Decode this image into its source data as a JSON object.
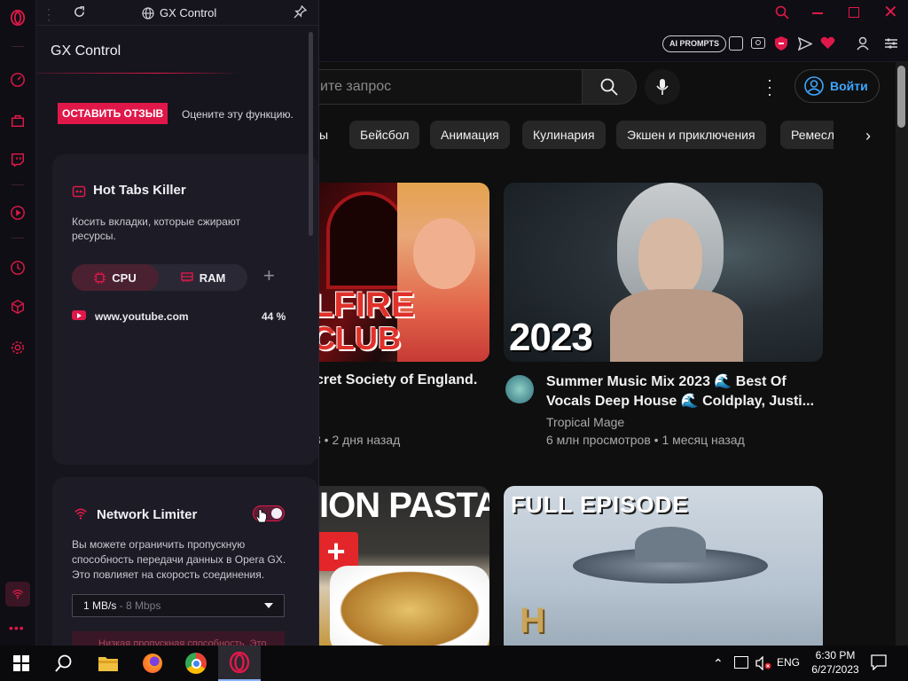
{
  "panel": {
    "header_title": "GX Control",
    "title": "GX Control",
    "feedback_button": "ОСТАВИТЬ ОТЗЫВ",
    "feedback_text": "Оцените эту функцию.",
    "tabs_killer": {
      "title": "Hot Tabs Killer",
      "description": "Косить вкладки, которые сжирают ресурсы.",
      "cpu_label": "CPU",
      "ram_label": "RAM",
      "active_tab": "CPU",
      "site": "www.youtube.com",
      "usage": "44 %"
    },
    "network_limiter": {
      "title": "Network Limiter",
      "enabled": true,
      "description": "Вы можете ограничить пропускную способность передачи данных в Opera GX. Это повлияет на скорость соединения.",
      "limit_value": "1 MB/s",
      "limit_sub": " - 8 Mbps",
      "cut_text": "Низкая пропускная способность. Это"
    }
  },
  "browser": {
    "ai_prompts": "AI PROMPTS"
  },
  "youtube": {
    "search_placeholder": "ите запрос",
    "signin": "Войти",
    "chips": [
      "ы",
      "Бейсбол",
      "Анимация",
      "Кулинария",
      "Экшен и приключения",
      "Ремесл"
    ],
    "videos": [
      {
        "title": "cret Society of England.",
        "channel": "",
        "meta": "3 • 2 дня назад",
        "thumb_text_1": "LFIRE",
        "thumb_text_2": "CLUB"
      },
      {
        "title_1": "Summer Music Mix 2023 🌊 Best Of",
        "title_2": "Vocals Deep House 🌊 Coldplay, Justi...",
        "channel": "Tropical Mage",
        "meta": "6 млн просмотров • 1 месяц назад",
        "thumb_text": "2023"
      },
      {
        "thumb_text": "ION PASTA?"
      },
      {
        "thumb_text": "FULL EPISODE",
        "badge": "H"
      }
    ]
  },
  "taskbar": {
    "lang": "ENG",
    "time": "6:30 PM",
    "date": "6/27/2023"
  },
  "colors": {
    "accent": "#e0184a",
    "panel_bg": "#16151d",
    "card_bg": "#1d1c26",
    "yt_bg": "#0f0f0f",
    "signin_blue": "#3ea6ff"
  }
}
